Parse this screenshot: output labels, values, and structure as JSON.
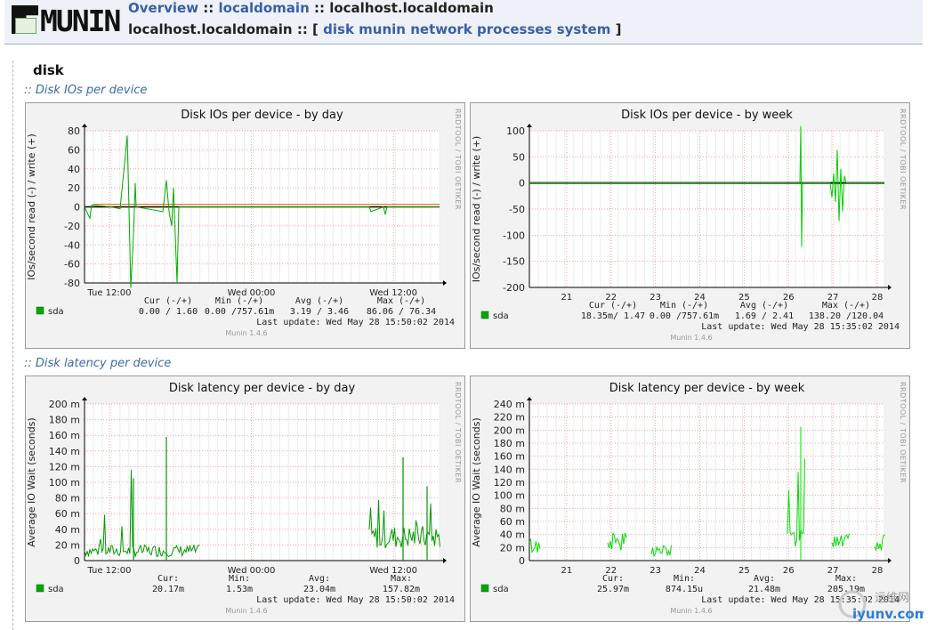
{
  "header": {
    "logo_text": "MUNIN",
    "overview_label": "Overview",
    "sep1": "::",
    "domain_label": "localdomain",
    "sep2": "::",
    "host_label": "localhost.localdomain",
    "host_prefix": "localhost.localdomain :: [",
    "categories": [
      "disk",
      "munin",
      "network",
      "processes",
      "system"
    ],
    "suffix": "]"
  },
  "page": {
    "section_title": "disk",
    "subsections": [
      ":: Disk IOs per device",
      ":: Disk latency per device"
    ]
  },
  "colors": {
    "link": "#3a5fa6",
    "series": "#00cc00",
    "grid_major": "#ff9999",
    "grid_minor": "#e0e0e0"
  },
  "graphs": [
    {
      "title": "Disk IOs per device - by day",
      "side_label": "RRDTOOL / TOBI OETIKER",
      "ylabel": "IOs/second read (-) / write (+)",
      "yticks": [
        "80",
        "60",
        "40",
        "20",
        "0",
        "-20",
        "-40",
        "-60",
        "-80"
      ],
      "xticks": [
        "Tue 12:00",
        "Wed 00:00",
        "Wed 12:00"
      ],
      "legend_cols": [
        "Cur (-/+)",
        "Min (-/+)",
        "Avg (-/+)",
        "Max (-/+)"
      ],
      "series_name": "sda",
      "legend_values": [
        "0.00 /  1.60",
        "0.00 /757.61m",
        "3.19 /  3.46",
        "86.06 / 76.34"
      ],
      "last_update": "Last update: Wed May 28 15:50:02 2014",
      "version": "Munin 1.4.6"
    },
    {
      "title": "Disk IOs per device - by week",
      "side_label": "RRDTOOL / TOBI OETIKER",
      "ylabel": "IOs/second read (-) / write (+)",
      "yticks": [
        "100",
        "50",
        "0",
        "-50",
        "-100",
        "-150",
        "-200"
      ],
      "xticks": [
        "21",
        "22",
        "23",
        "24",
        "25",
        "26",
        "27",
        "28"
      ],
      "legend_cols": [
        "Cur (-/+)",
        "Min (-/+)",
        "Avg (-/+)",
        "Max (-/+)"
      ],
      "series_name": "sda",
      "legend_values": [
        "18.35m/  1.47",
        "0.00 /757.61m",
        "1.69 /  2.41",
        "138.20 /120.04"
      ],
      "last_update": "Last update: Wed May 28 15:35:02 2014",
      "version": "Munin 1.4.6"
    },
    {
      "title": "Disk latency per device - by day",
      "side_label": "RRDTOOL / TOBI OETIKER",
      "ylabel": "Average IO Wait (seconds)",
      "yticks": [
        "200 m",
        "180 m",
        "160 m",
        "140 m",
        "120 m",
        "100 m",
        "80 m",
        "60 m",
        "40 m",
        "20 m",
        "0"
      ],
      "xticks": [
        "Tue 12:00",
        "Wed 00:00",
        "Wed 12:00"
      ],
      "legend_cols": [
        "Cur:",
        "Min:",
        "Avg:",
        "Max:"
      ],
      "series_name": "sda",
      "legend_values": [
        "20.17m",
        "1.53m",
        "23.04m",
        "157.82m"
      ],
      "last_update": "Last update: Wed May 28 15:50:02 2014",
      "version": "Munin 1.4.6"
    },
    {
      "title": "Disk latency per device - by week",
      "side_label": "RRDTOOL / TOBI OETIKER",
      "ylabel": "Average IO Wait (seconds)",
      "yticks": [
        "240 m",
        "220 m",
        "200 m",
        "180 m",
        "160 m",
        "140 m",
        "120 m",
        "100 m",
        "80 m",
        "60 m",
        "40 m",
        "20 m",
        "0"
      ],
      "xticks": [
        "21",
        "22",
        "23",
        "24",
        "25",
        "26",
        "27",
        "28"
      ],
      "legend_cols": [
        "Cur:",
        "Min:",
        "Avg:",
        "Max:"
      ],
      "series_name": "sda",
      "legend_values": [
        "25.97m",
        "874.15u",
        "21.48m",
        "205.19m"
      ],
      "last_update": "Last update: Wed May 28 15:35:02 2014",
      "version": "Munin 1.4.6"
    }
  ],
  "watermark": {
    "top": "运维网",
    "bottom": "iyunv.com"
  }
}
